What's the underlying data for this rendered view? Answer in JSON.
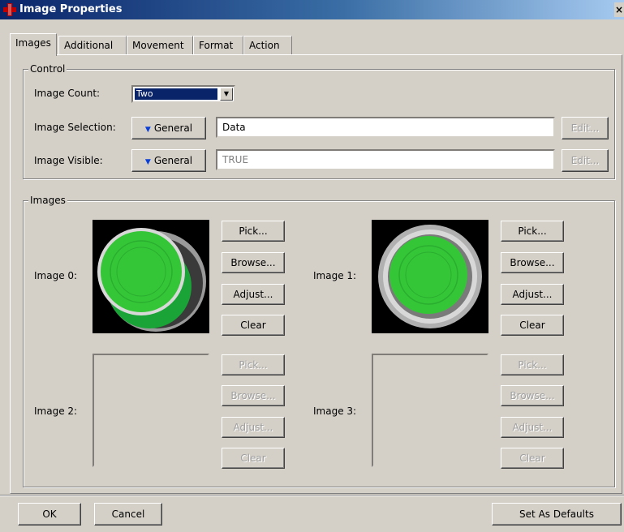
{
  "window": {
    "title": "Image Properties",
    "close_glyph": "×"
  },
  "tabs": [
    {
      "label": "Images"
    },
    {
      "label": "Additional"
    },
    {
      "label": "Movement"
    },
    {
      "label": "Format"
    },
    {
      "label": "Action"
    }
  ],
  "control": {
    "legend": "Control",
    "image_count": {
      "label": "Image Count:",
      "value": "Two"
    },
    "image_selection": {
      "label": "Image Selection:",
      "mode": "General",
      "value": "Data",
      "edit_label": "Edit..."
    },
    "image_visible": {
      "label": "Image Visible:",
      "mode": "General",
      "value": "TRUE",
      "edit_label": "Edit..."
    }
  },
  "images": {
    "legend": "Images",
    "items": [
      {
        "label": "Image 0:",
        "pick": "Pick...",
        "browse": "Browse...",
        "adjust": "Adjust...",
        "clear": "Clear"
      },
      {
        "label": "Image 1:",
        "pick": "Pick...",
        "browse": "Browse...",
        "adjust": "Adjust...",
        "clear": "Clear"
      },
      {
        "label": "Image 2:",
        "pick": "Pick...",
        "browse": "Browse...",
        "adjust": "Adjust...",
        "clear": "Clear"
      },
      {
        "label": "Image 3:",
        "pick": "Pick...",
        "browse": "Browse...",
        "adjust": "Adjust...",
        "clear": "Clear"
      }
    ]
  },
  "footer": {
    "ok": "OK",
    "cancel": "Cancel",
    "set_defaults": "Set As Defaults"
  },
  "colors": {
    "title_bar": "#0a246a",
    "face": "#d4d0c8",
    "button_green": "#2ecc40",
    "dropdown_arrow": "#0a3fd8"
  }
}
